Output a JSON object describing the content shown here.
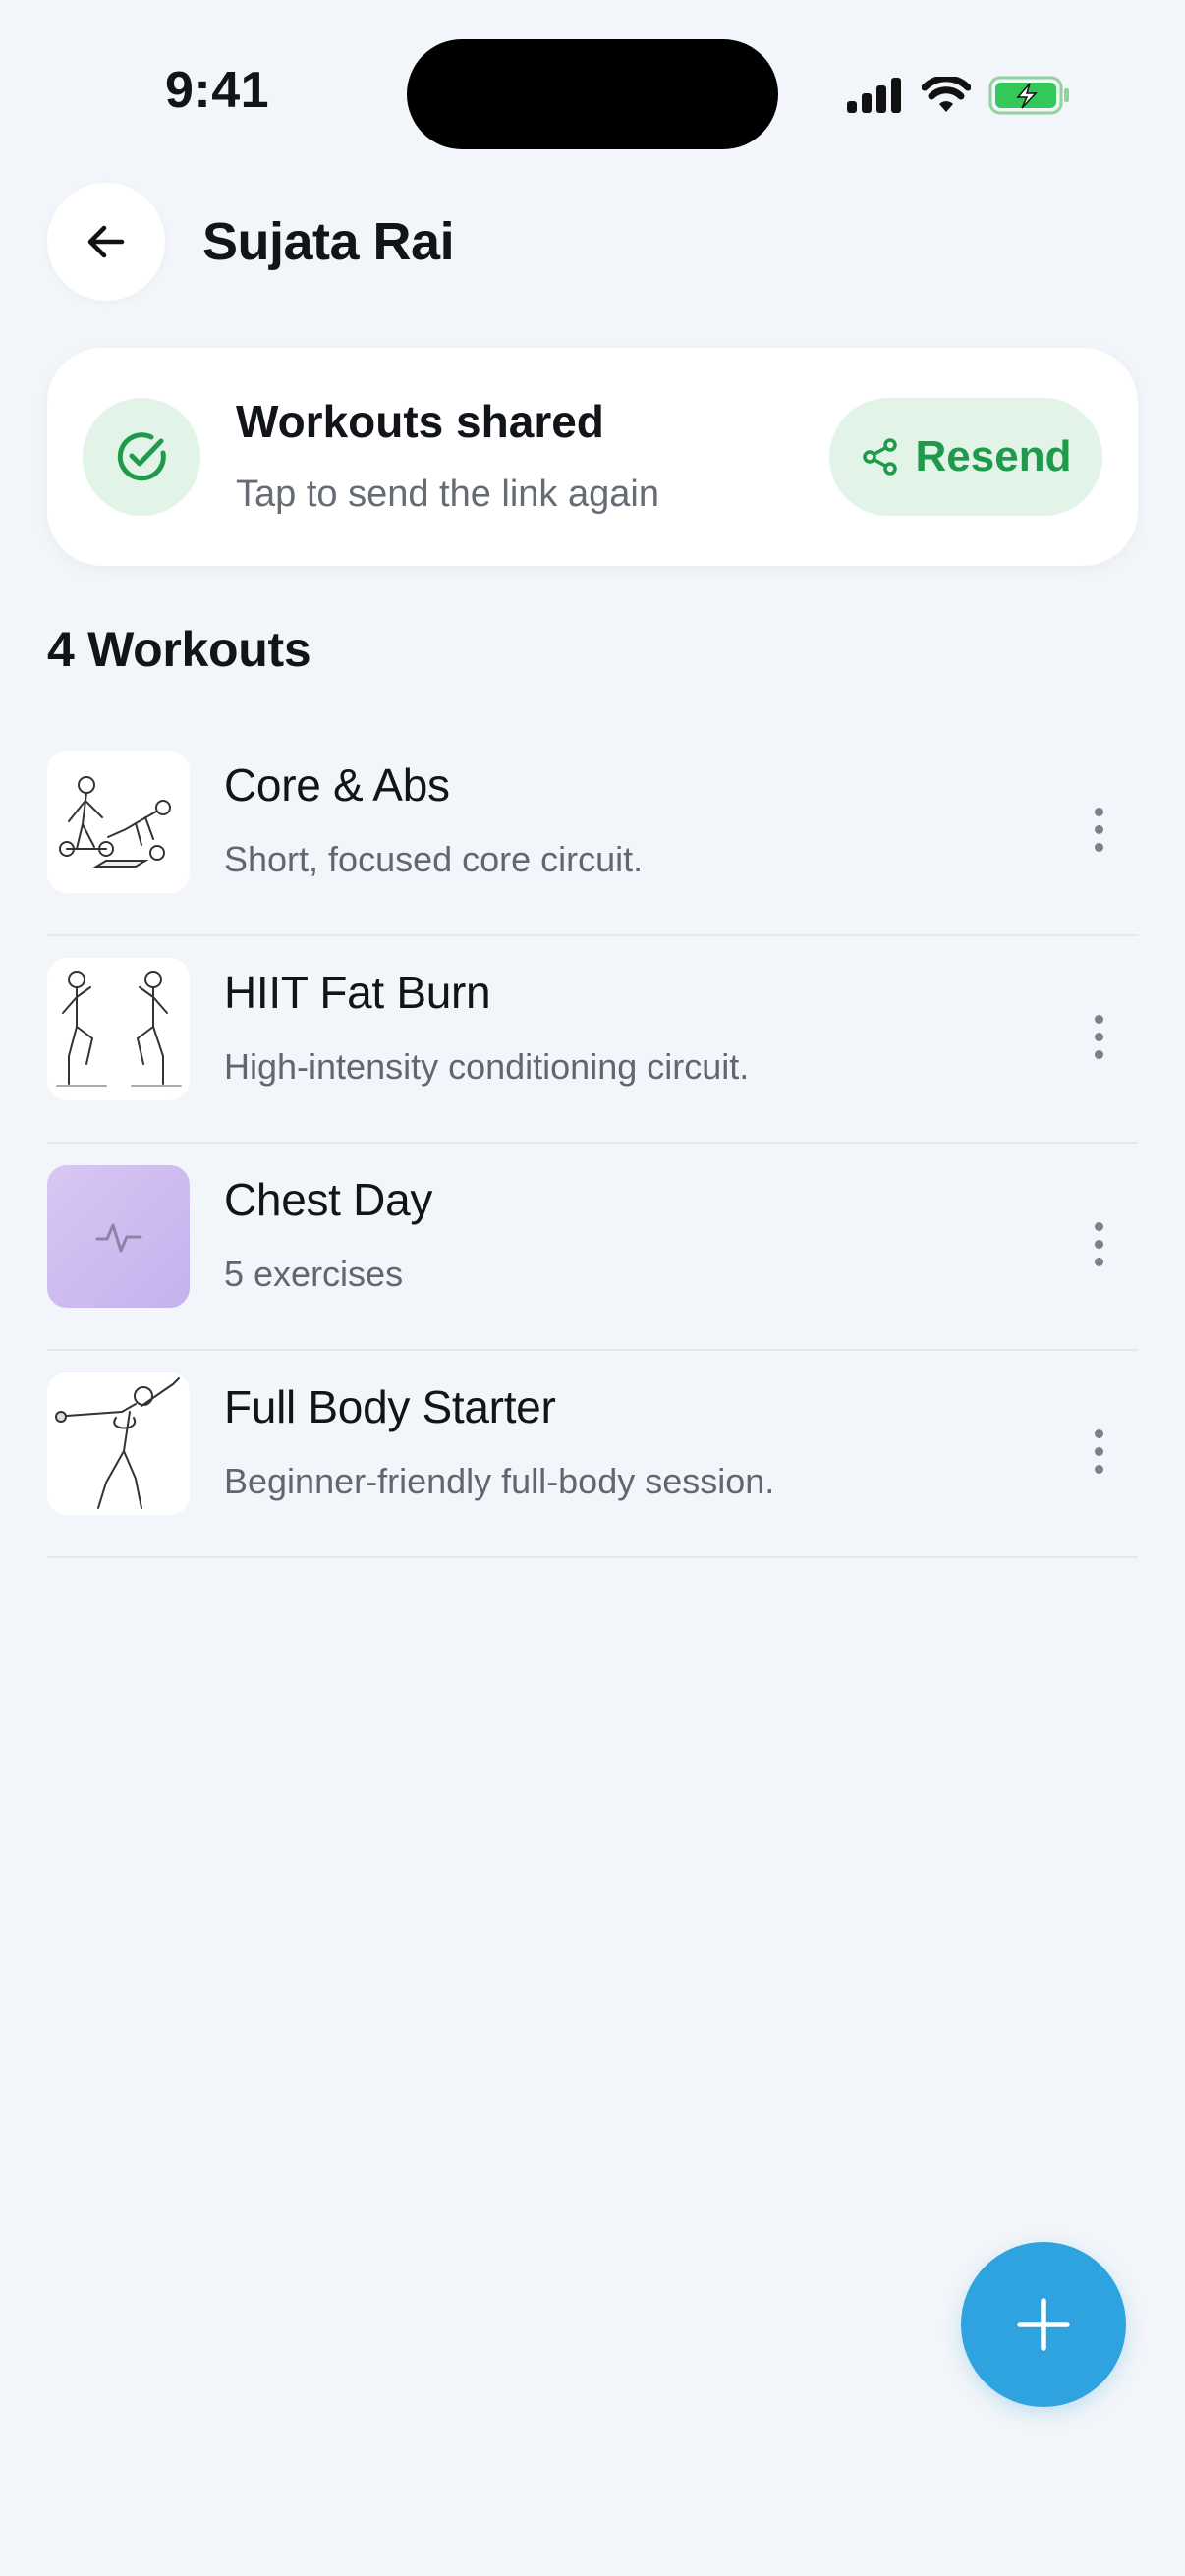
{
  "status_bar": {
    "time": "9:41"
  },
  "header": {
    "title": "Sujata Rai",
    "back_icon": "arrow-left-icon"
  },
  "share_card": {
    "title": "Workouts shared",
    "subtitle": "Tap to send the link again",
    "icon": "check-circle-icon",
    "resend_label": "Resend",
    "resend_icon": "share-icon",
    "accent_color": "#1e9a4a",
    "accent_bg": "#e2f3e7"
  },
  "workouts": {
    "count_label": "4 Workouts",
    "items": [
      {
        "title": "Core & Abs",
        "subtitle": "Short, focused core circuit."
      },
      {
        "title": "HIIT Fat Burn",
        "subtitle": "High-intensity conditioning circuit."
      },
      {
        "title": "Chest Day",
        "subtitle": "5 exercises"
      },
      {
        "title": "Full Body Starter",
        "subtitle": "Beginner-friendly full-body session."
      }
    ]
  },
  "fab": {
    "icon": "plus-icon",
    "color": "#2fa3df"
  }
}
